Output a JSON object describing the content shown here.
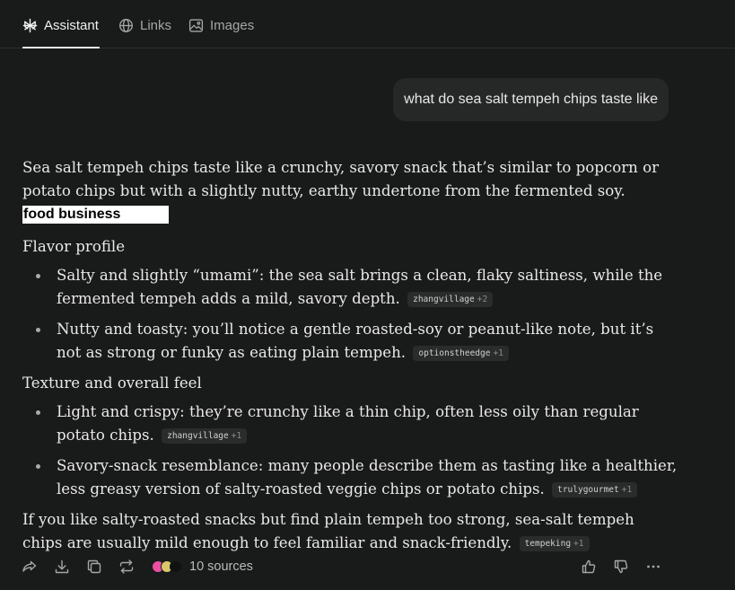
{
  "tabs": {
    "assistant": "Assistant",
    "links": "Links",
    "images": "Images"
  },
  "query": "what do sea salt tempeh chips taste like",
  "answer": {
    "intro": "Sea salt tempeh chips taste like a crunchy, savory snack that’s similar to popcorn or potato chips but with a slightly nutty, earthy undertone from the fermented soy.",
    "highlight": "food business",
    "sections": [
      {
        "heading": "Flavor profile",
        "items": [
          {
            "text": "Salty and slightly “umami”: the sea salt brings a clean, flaky saltiness, while the fermented tempeh adds a mild, savory depth.",
            "source": "zhangvillage",
            "count": "+2"
          },
          {
            "text": "Nutty and toasty: you’ll notice a gentle roasted-soy or peanut-like note, but it’s not as strong or funky as eating plain tempeh.",
            "source": "optionstheedge",
            "count": "+1"
          }
        ]
      },
      {
        "heading": "Texture and overall feel",
        "items": [
          {
            "text": "Light and crispy: they’re crunchy like a thin chip, often less oily than regular potato chips.",
            "source": "zhangvillage",
            "count": "+1"
          },
          {
            "text": "Savory-snack resemblance: many people describe them as tasting like a healthier, less greasy version of salty-roasted veggie chips or potato chips.",
            "source": "trulygourmet",
            "count": "+1"
          }
        ]
      }
    ],
    "closing": {
      "text": "If you like salty-roasted snacks but find plain tempeh too strong, sea-salt tempeh chips are usually mild enough to feel familiar and snack-friendly.",
      "source": "tempeking",
      "count": "+1"
    }
  },
  "footer": {
    "sources_label": "10 sources",
    "source_colors": [
      "#e94fa0",
      "#d9c86a",
      "#111111"
    ],
    "icons": [
      "share-icon",
      "download-icon",
      "copy-icon",
      "rewrite-icon",
      "thumbs-up-icon",
      "thumbs-down-icon",
      "more-icon"
    ]
  },
  "colors": {
    "background": "#191a1a",
    "text": "#e9e9e7",
    "muted": "#a5a7a6",
    "chip_bg": "#2a2c2c",
    "bubble_bg": "#262828"
  }
}
